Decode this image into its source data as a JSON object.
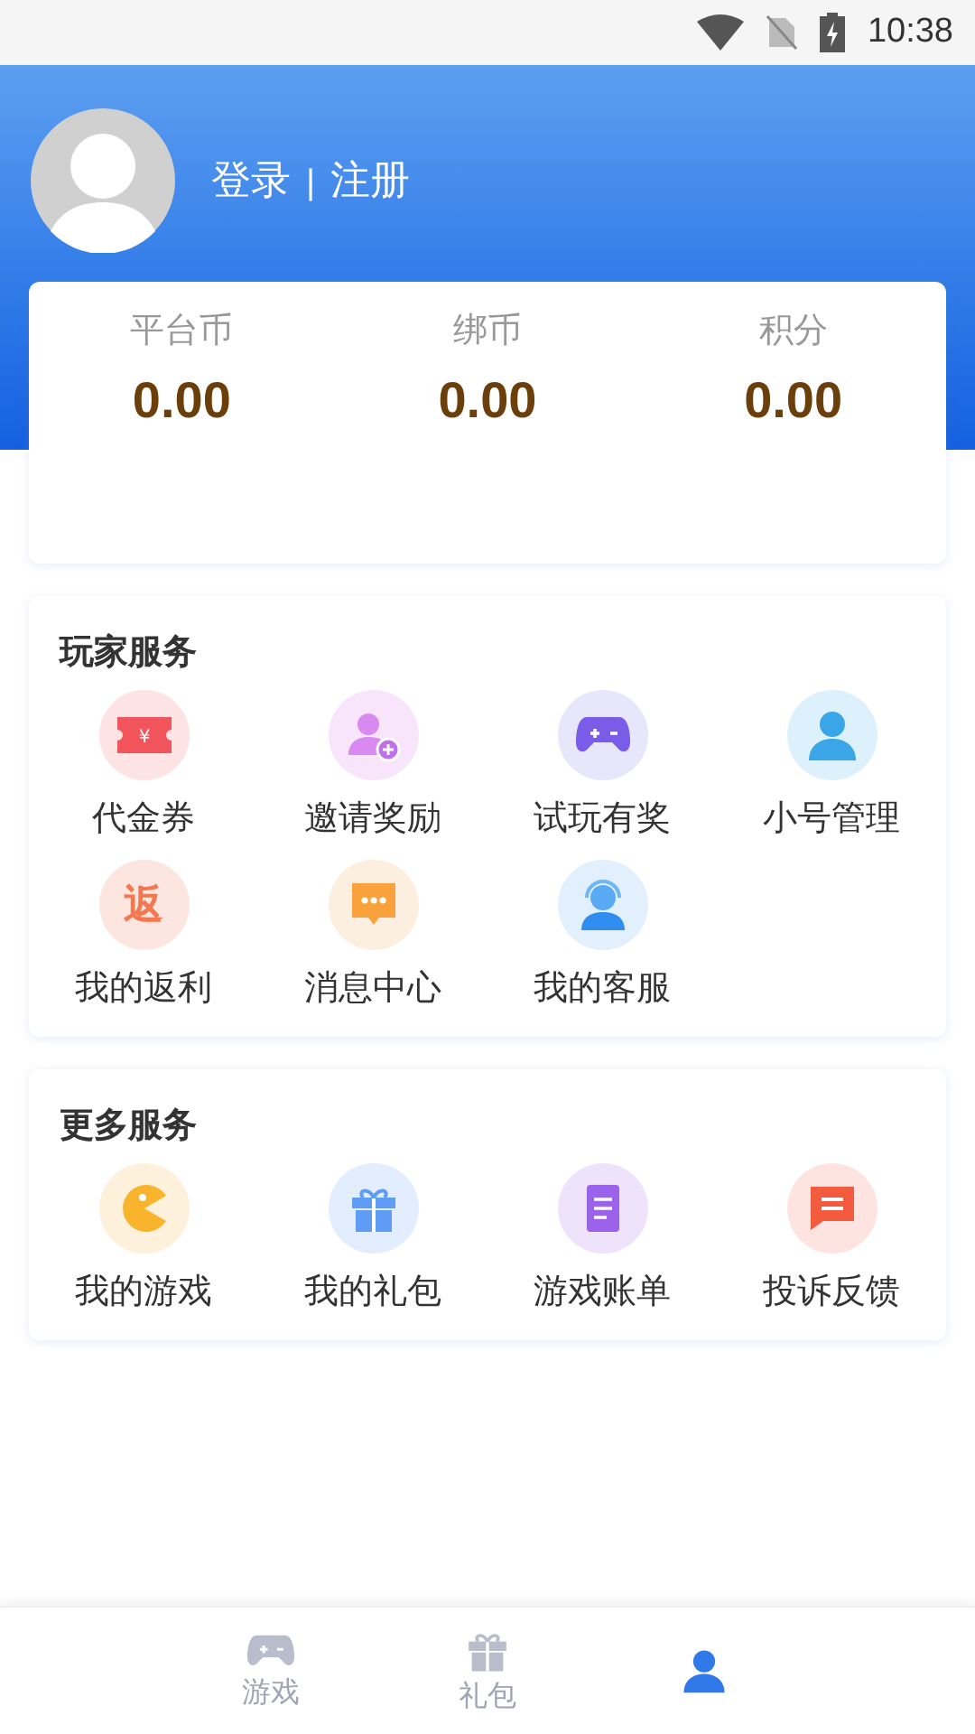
{
  "status_bar": {
    "time": "10:38"
  },
  "header": {
    "login": "登录",
    "divider": "|",
    "register": "注册"
  },
  "balances": [
    {
      "label": "平台币",
      "value": "0.00"
    },
    {
      "label": "绑币",
      "value": "0.00"
    },
    {
      "label": "积分",
      "value": "0.00"
    }
  ],
  "sections": [
    {
      "title": "玩家服务",
      "items": [
        {
          "label": "代金券",
          "kind": "ticket",
          "glyph": "¥"
        },
        {
          "label": "邀请奖励",
          "kind": "invite"
        },
        {
          "label": "试玩有奖",
          "kind": "gamepad"
        },
        {
          "label": "小号管理",
          "kind": "user"
        },
        {
          "label": "我的返利",
          "kind": "glyph",
          "glyph": "返"
        },
        {
          "label": "消息中心",
          "kind": "chat"
        },
        {
          "label": "我的客服",
          "kind": "headset"
        }
      ]
    },
    {
      "title": "更多服务",
      "items": [
        {
          "label": "我的游戏",
          "kind": "pacman"
        },
        {
          "label": "我的礼包",
          "kind": "gift"
        },
        {
          "label": "游戏账单",
          "kind": "bill"
        },
        {
          "label": "投诉反馈",
          "kind": "feedback"
        }
      ]
    }
  ],
  "tab_bar": [
    {
      "label": "游戏",
      "kind": "gamepad",
      "selected": false
    },
    {
      "label": "礼包",
      "kind": "gift",
      "selected": false
    },
    {
      "kind": "user",
      "selected": true
    }
  ]
}
